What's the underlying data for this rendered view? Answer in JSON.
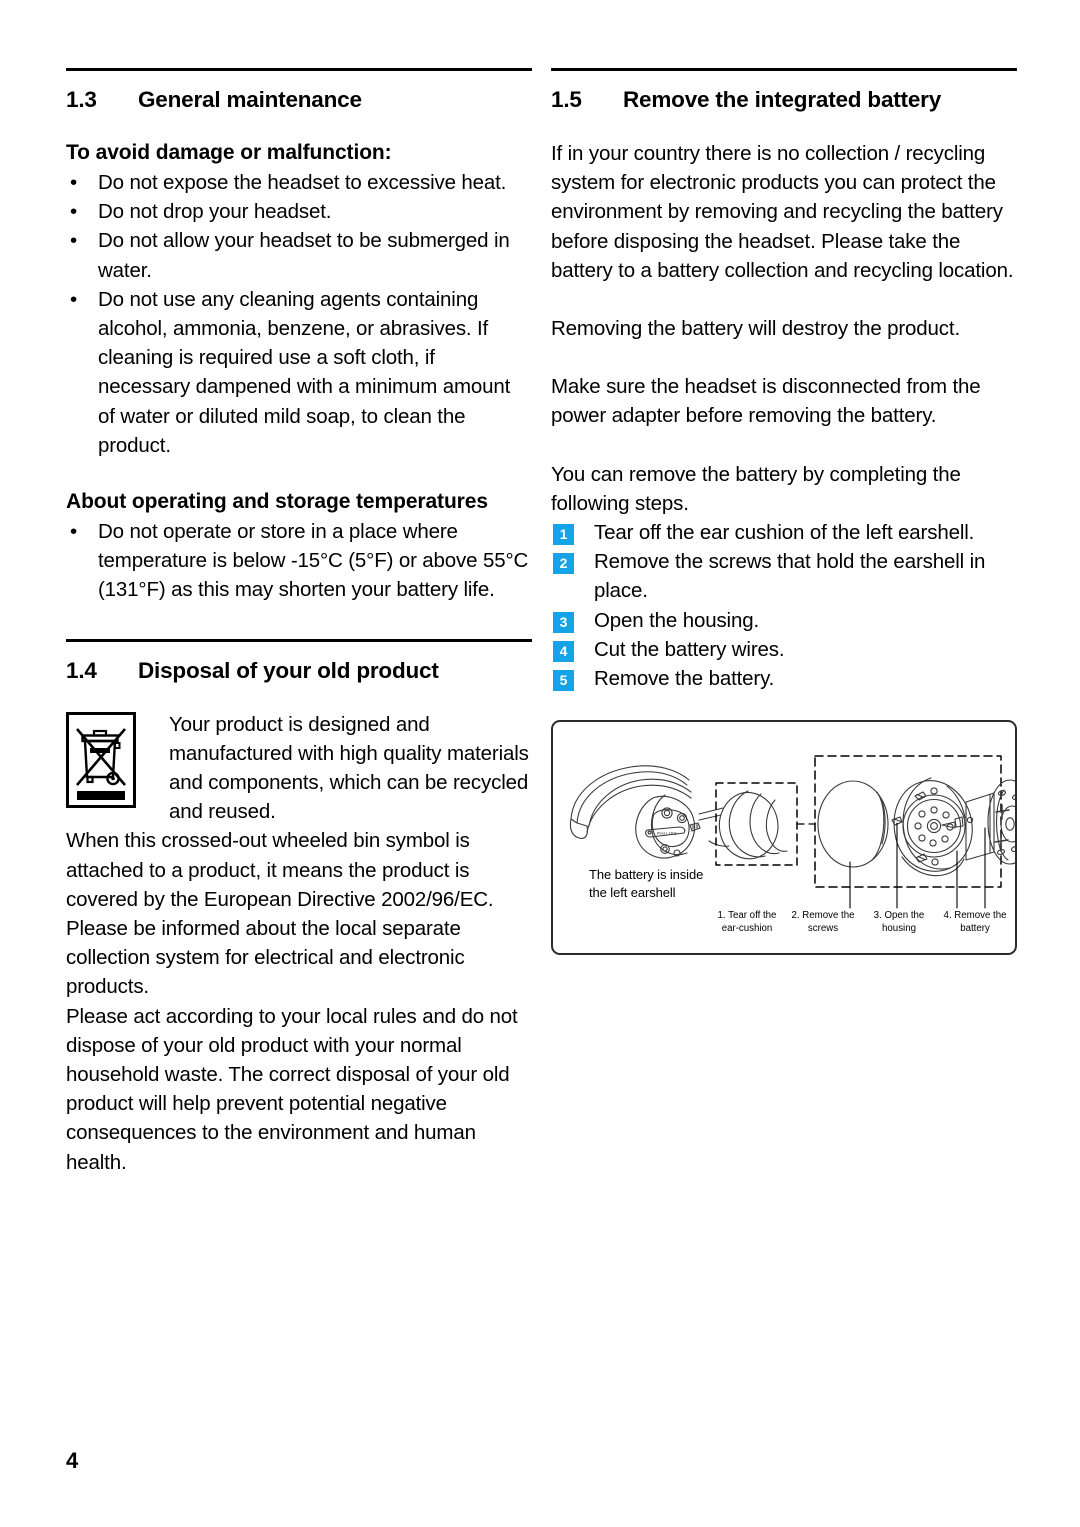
{
  "page": {
    "number": "4"
  },
  "left_column": {
    "section": {
      "number": "1.3",
      "title": "General maintenance"
    },
    "sub_head_1": "To avoid damage or malfunction:",
    "bullets_1": [
      "Do not expose the headset to excessive heat.",
      "Do not drop your headset.",
      "Do not allow your headset to be submerged in water.",
      "Do not use any cleaning agents containing alcohol, ammonia, benzene, or abrasives. If cleaning is required use a soft cloth, if necessary dampened with a minimum amount of water or diluted mild soap, to clean the product."
    ],
    "sub_head_2": "About operating and storage temperatures",
    "bullets_2": [
      "Do not operate or store in a place where temperature is below -15°C (5°F) or above 55°C (131°F) as this may shorten your battery life."
    ],
    "section_2": {
      "number": "1.4",
      "title": "Disposal of your old product"
    },
    "weee_icon_name": "crossed-out-wheeled-bin-icon",
    "weee_intro": "Your product is designed and manufactured with high quality materials and components, which can be recycled and reused.",
    "weee_paragraph_1": "When this crossed-out wheeled bin symbol is attached to a product, it means the product is covered by the European Directive 2002/96/EC. Please be informed about the local separate collection system for electrical and electronic products.",
    "weee_paragraph_2": "Please act according to your local rules and do not dispose of your old product with your normal household waste. The correct disposal of your old product will help prevent potential negative consequences to the environment and human health."
  },
  "right_column": {
    "section": {
      "number": "1.5",
      "title": "Remove the integrated battery"
    },
    "paragraph_1": "If in your country there is no collection / recycling system for electronic products you can protect the environment by removing and recycling the battery before disposing the headset. Please take the battery to a battery collection and recycling location.",
    "paragraph_2": "Removing the battery will destroy the product.",
    "paragraph_3": "Make sure the headset is disconnected from the power adapter before removing the battery.",
    "paragraph_4": "You can remove the battery by completing the following steps.",
    "steps": [
      {
        "num": "1",
        "text": "Tear off the ear cushion of the left earshell."
      },
      {
        "num": "2",
        "text": "Remove the screws that hold the earshell in place."
      },
      {
        "num": "3",
        "text": "Open the housing."
      },
      {
        "num": "4",
        "text": "Cut the battery wires."
      },
      {
        "num": "5",
        "text": "Remove the battery."
      }
    ],
    "illustration": {
      "note_line_1": "The battery is inside",
      "note_line_2": "the left earshell",
      "captions": [
        {
          "line1": "1. Tear off the",
          "line2": "ear-cushion"
        },
        {
          "line1": "2. Remove the",
          "line2": "screws"
        },
        {
          "line1": "3. Open the",
          "line2": "housing"
        },
        {
          "line1": "4. Remove the",
          "line2": "battery"
        }
      ]
    }
  },
  "colors": {
    "badge_blue": "#14a3e6",
    "text": "#000000",
    "illustration_border": "#2b2b2b"
  }
}
